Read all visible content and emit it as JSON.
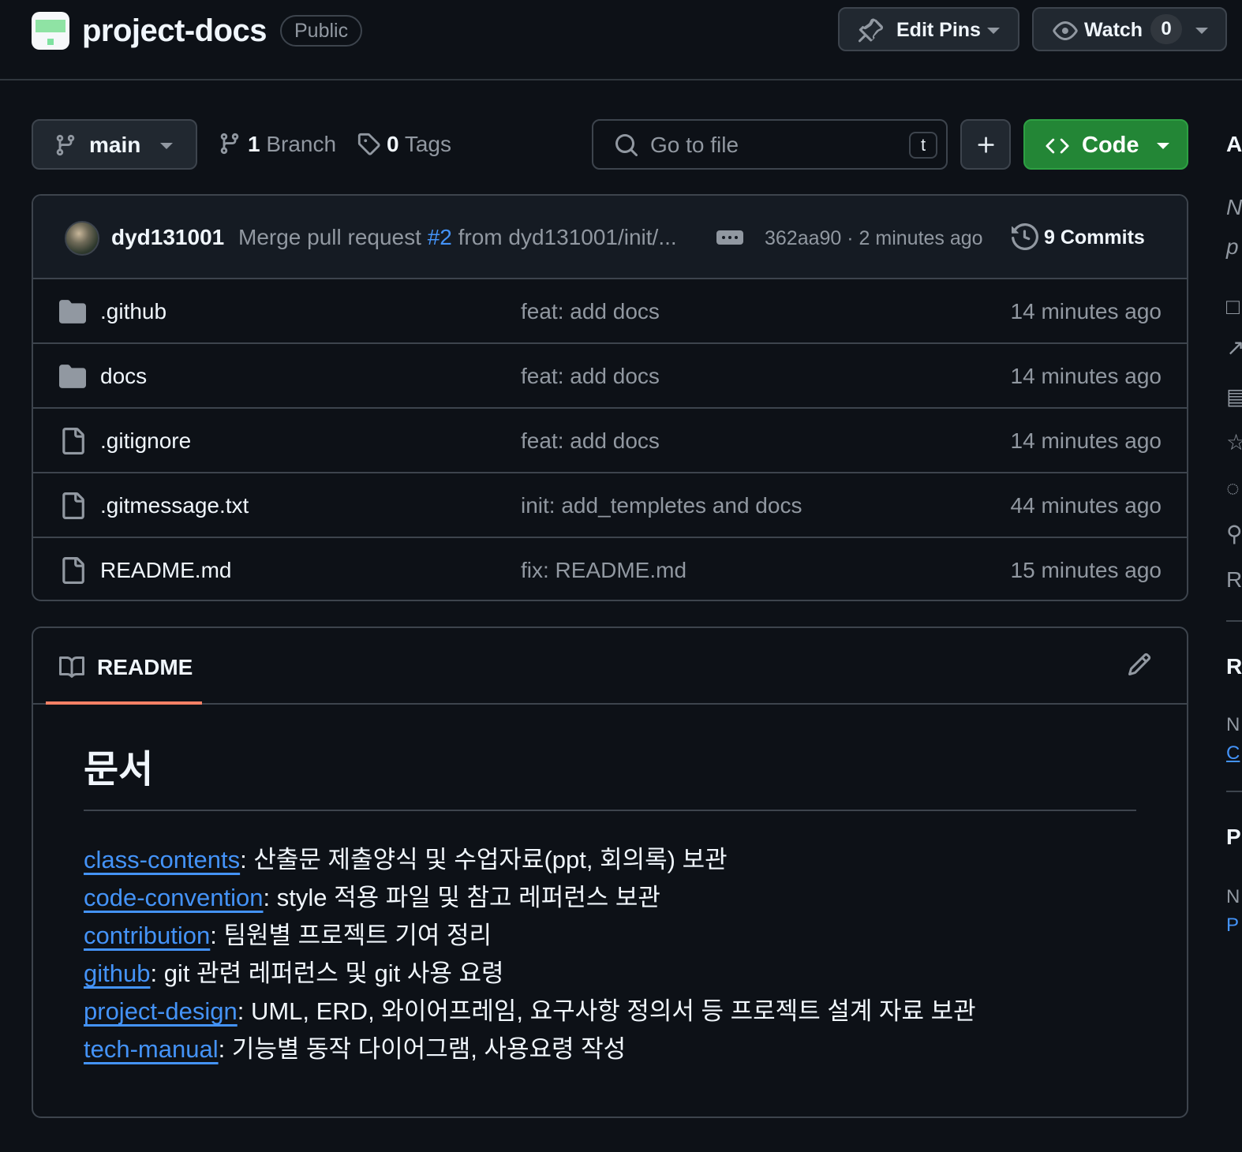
{
  "repo": {
    "name": "project-docs",
    "visibility": "Public",
    "edit_pins_label": "Edit Pins",
    "watch_label": "Watch",
    "watch_count": "0"
  },
  "toolbar": {
    "branch": "main",
    "branch_count": "1",
    "branch_label": "Branch",
    "tag_count": "0",
    "tag_label": "Tags",
    "goto_placeholder": "Go to file",
    "goto_shortcut": "t",
    "code_label": "Code"
  },
  "last_commit": {
    "author": "dyd131001",
    "message_prefix": "Merge pull request ",
    "pr_ref": "#2",
    "message_suffix": " from dyd131001/init/...",
    "sha": "362aa90",
    "separator": " · ",
    "time": "2 minutes ago",
    "commits_count": "9",
    "commits_label": "Commits"
  },
  "files": [
    {
      "type": "folder",
      "name": ".github",
      "message": "feat: add docs",
      "time": "14 minutes ago"
    },
    {
      "type": "folder",
      "name": "docs",
      "message": "feat: add docs",
      "time": "14 minutes ago"
    },
    {
      "type": "file",
      "name": ".gitignore",
      "message": "feat: add docs",
      "time": "14 minutes ago"
    },
    {
      "type": "file",
      "name": ".gitmessage.txt",
      "message": "init: add_templetes and docs",
      "time": "44 minutes ago"
    },
    {
      "type": "file",
      "name": "README.md",
      "message": "fix: README.md",
      "time": "15 minutes ago"
    }
  ],
  "readme": {
    "tab_label": "README",
    "heading": "문서",
    "entries": [
      {
        "link": "class-contents",
        "text": ": 산출문 제출양식 및 수업자료(ppt, 회의록) 보관"
      },
      {
        "link": "code-convention",
        "text": ": style 적용 파일 및 참고 레퍼런스 보관"
      },
      {
        "link": "contribution",
        "text": ": 팀원별 프로젝트 기여 정리"
      },
      {
        "link": "github",
        "text": ": git 관련 레퍼런스 및 git 사용 요령"
      },
      {
        "link": "project-design",
        "text": ": UML, ERD, 와이어프레임, 요구사항 정의서 등 프로젝트 설계 자료 보관"
      },
      {
        "link": "tech-manual",
        "text": ": 기능별 동작 다이어그램, 사용요령 작성"
      }
    ]
  },
  "sidebar_fragments": {
    "about": "A",
    "desc1": "N",
    "desc2": "p",
    "readme_icon_row": "R",
    "releases": "R",
    "releases_note": "N",
    "releases_link": "C",
    "packages": "P",
    "packages_note": "N",
    "packages_link": "P"
  },
  "colors": {
    "background": "#0d1117",
    "border": "#3d444d",
    "accent_green": "#238636",
    "link_blue": "#4493f8",
    "tab_underline": "#f78166"
  }
}
